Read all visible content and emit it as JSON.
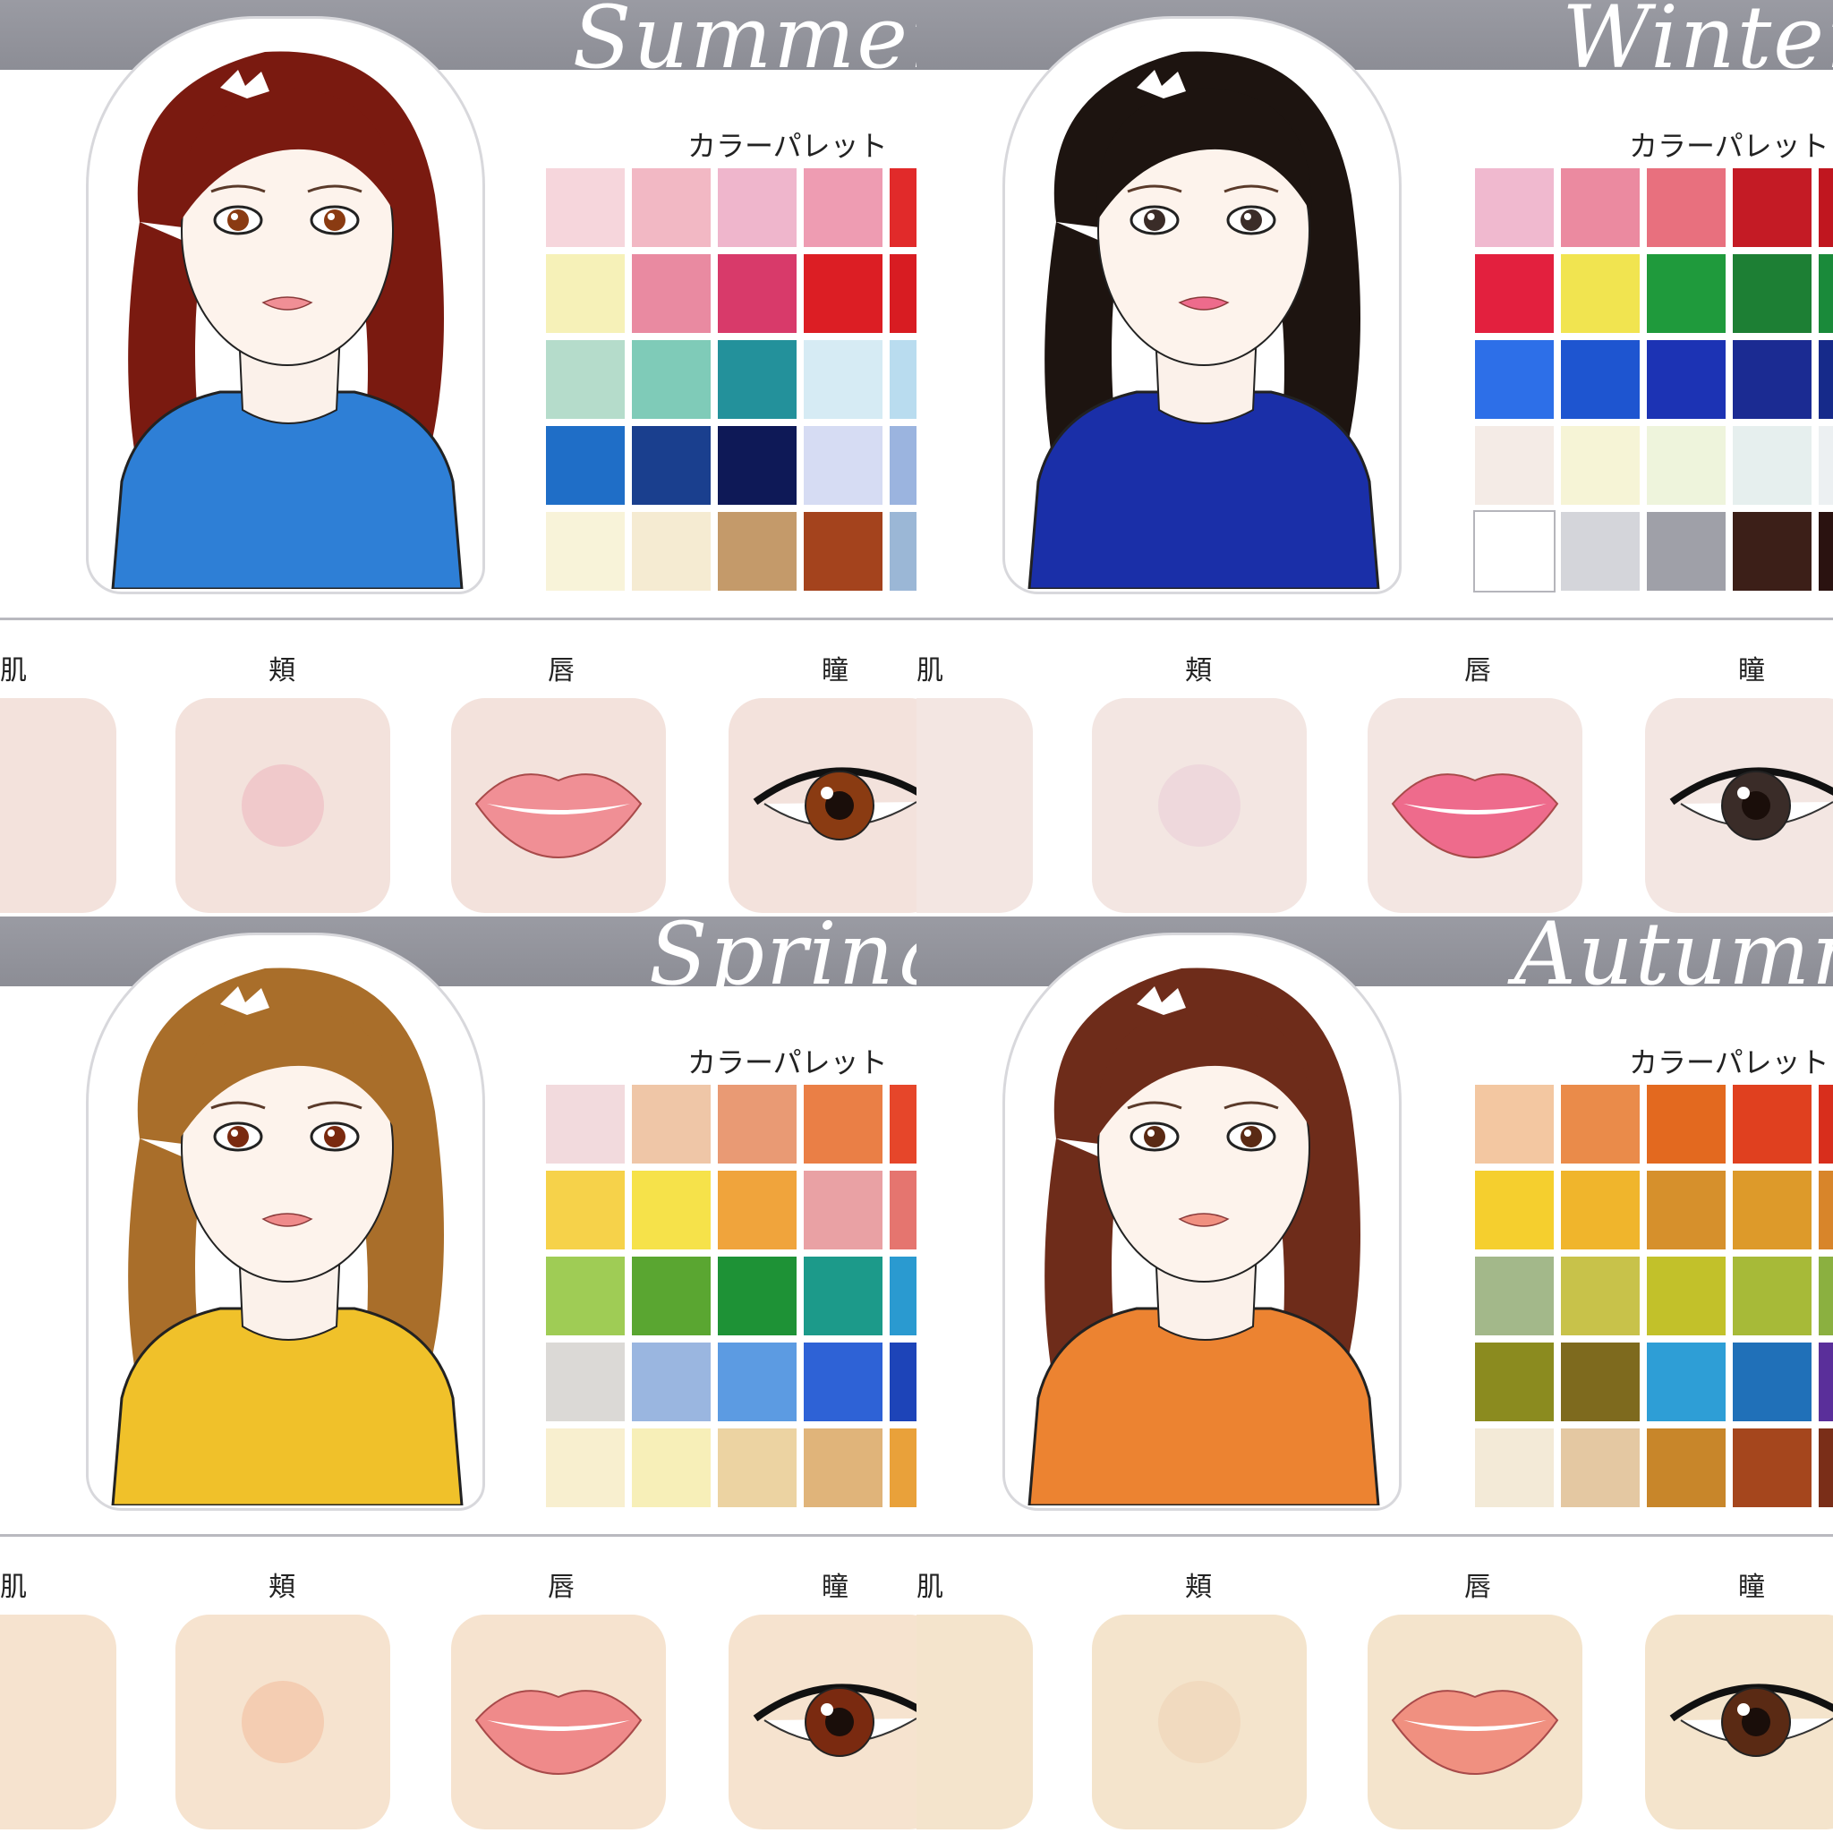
{
  "palette_label": "カラーパレット",
  "feature_labels": {
    "skin": "肌",
    "cheek": "頬",
    "lip": "唇",
    "eye": "瞳"
  },
  "panels": [
    {
      "season": "Summer",
      "hair": "#7a1a10",
      "shirt": "#2e7fd6",
      "skin_tile": "#f3e2dc",
      "cheek": "#efc4c8",
      "lip": "#f08f95",
      "iris": "#8a3b12",
      "palette": [
        "#f6d6dc",
        "#f2b8c4",
        "#efb6cc",
        "#ee9cb2",
        "#e12a2a",
        "#f6f1b8",
        "#e98aa1",
        "#d83a6a",
        "#dc1e24",
        "#d81c22",
        "#b5dccb",
        "#7fcbb8",
        "#23919b",
        "#d6ebf4",
        "#b9dcef",
        "#1f6ec7",
        "#1a3f8e",
        "#0e1957",
        "#d6dcf3",
        "#9bb4df",
        "#f8f3d9",
        "#f5ebd2",
        "#c49a6a",
        "#a4431d",
        "#9bb7d6"
      ]
    },
    {
      "season": "Winter",
      "hair": "#1d1410",
      "shirt": "#1a2fa8",
      "skin_tile": "#f3e6e2",
      "cheek": "#ecd5da",
      "lip": "#ee6b8c",
      "iris": "#3a2c28",
      "palette": [
        "#f0b9cf",
        "#eb8aa0",
        "#e8707e",
        "#c41b25",
        "#c0161f",
        "#e3203e",
        "#f1e450",
        "#1f9a3c",
        "#1d7f34",
        "#1a8a3a",
        "#2d6fe8",
        "#1e55d0",
        "#1c33b4",
        "#1b2b92",
        "#162a8a",
        "#f4ebe6",
        "#f6f4d6",
        "#eef4dc",
        "#e6efee",
        "#ecf0f2",
        "#ffffff",
        "#d4d5da",
        "#9fa0a8",
        "#3c1f18",
        "#2a1210"
      ]
    },
    {
      "season": "Spring",
      "hair": "#a96e2a",
      "shirt": "#f0c12a",
      "skin_tile": "#f6e3cf",
      "cheek": "#f3c9ad",
      "lip": "#ef8a8a",
      "iris": "#7a2a10",
      "palette": [
        "#f2dadd",
        "#efc6a7",
        "#e99a74",
        "#ea7f46",
        "#e6462a",
        "#f6d24a",
        "#f6e24a",
        "#f0a43c",
        "#e9a1a4",
        "#e5756f",
        "#9fcc55",
        "#5aa631",
        "#1e9236",
        "#1c9a8a",
        "#2a9ad0",
        "#dbd9d6",
        "#9ab6e0",
        "#5c9be2",
        "#2e62d6",
        "#1d44b8",
        "#f8efcf",
        "#f7efb8",
        "#ecd3a2",
        "#e0b47a",
        "#e9a13a"
      ]
    },
    {
      "season": "Autumn",
      "hair": "#6e2c1a",
      "shirt": "#ec8331",
      "skin_tile": "#f4e4cc",
      "cheek": "#f0d8bc",
      "lip": "#f09080",
      "iris": "#5a2a14",
      "palette": [
        "#f3c7a1",
        "#ea8b4a",
        "#e3691f",
        "#e0401f",
        "#d82e1c",
        "#f5cf2e",
        "#f0b52c",
        "#d6902c",
        "#dd9a2a",
        "#d8852a",
        "#a3b88a",
        "#c8c24a",
        "#c2c12a",
        "#a7ba38",
        "#8bb040",
        "#8b8b1f",
        "#7e6a1e",
        "#2e9ed6",
        "#2070b8",
        "#5a2f9a",
        "#f3ead7",
        "#e4c8a2",
        "#c8862a",
        "#a5461d",
        "#7a2e18"
      ]
    }
  ]
}
